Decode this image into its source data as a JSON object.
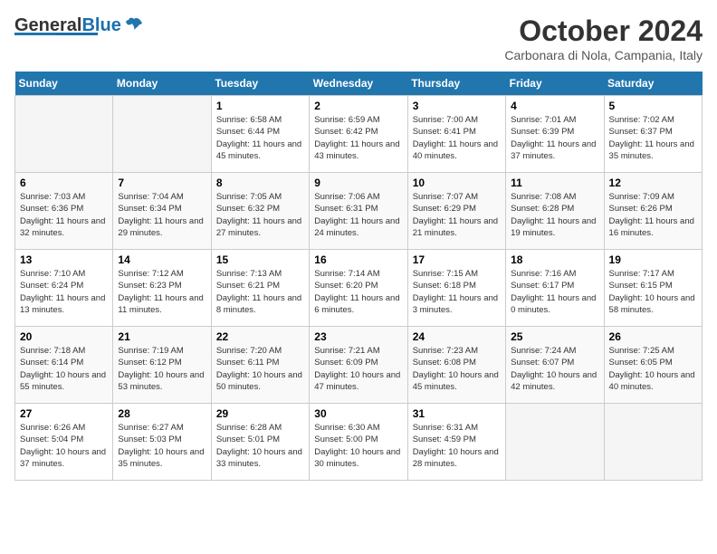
{
  "header": {
    "logo_general": "General",
    "logo_blue": "Blue",
    "title": "October 2024",
    "subtitle": "Carbonara di Nola, Campania, Italy"
  },
  "weekdays": [
    "Sunday",
    "Monday",
    "Tuesday",
    "Wednesday",
    "Thursday",
    "Friday",
    "Saturday"
  ],
  "weeks": [
    [
      {
        "day": "",
        "info": ""
      },
      {
        "day": "",
        "info": ""
      },
      {
        "day": "1",
        "info": "Sunrise: 6:58 AM\nSunset: 6:44 PM\nDaylight: 11 hours and 45 minutes."
      },
      {
        "day": "2",
        "info": "Sunrise: 6:59 AM\nSunset: 6:42 PM\nDaylight: 11 hours and 43 minutes."
      },
      {
        "day": "3",
        "info": "Sunrise: 7:00 AM\nSunset: 6:41 PM\nDaylight: 11 hours and 40 minutes."
      },
      {
        "day": "4",
        "info": "Sunrise: 7:01 AM\nSunset: 6:39 PM\nDaylight: 11 hours and 37 minutes."
      },
      {
        "day": "5",
        "info": "Sunrise: 7:02 AM\nSunset: 6:37 PM\nDaylight: 11 hours and 35 minutes."
      }
    ],
    [
      {
        "day": "6",
        "info": "Sunrise: 7:03 AM\nSunset: 6:36 PM\nDaylight: 11 hours and 32 minutes."
      },
      {
        "day": "7",
        "info": "Sunrise: 7:04 AM\nSunset: 6:34 PM\nDaylight: 11 hours and 29 minutes."
      },
      {
        "day": "8",
        "info": "Sunrise: 7:05 AM\nSunset: 6:32 PM\nDaylight: 11 hours and 27 minutes."
      },
      {
        "day": "9",
        "info": "Sunrise: 7:06 AM\nSunset: 6:31 PM\nDaylight: 11 hours and 24 minutes."
      },
      {
        "day": "10",
        "info": "Sunrise: 7:07 AM\nSunset: 6:29 PM\nDaylight: 11 hours and 21 minutes."
      },
      {
        "day": "11",
        "info": "Sunrise: 7:08 AM\nSunset: 6:28 PM\nDaylight: 11 hours and 19 minutes."
      },
      {
        "day": "12",
        "info": "Sunrise: 7:09 AM\nSunset: 6:26 PM\nDaylight: 11 hours and 16 minutes."
      }
    ],
    [
      {
        "day": "13",
        "info": "Sunrise: 7:10 AM\nSunset: 6:24 PM\nDaylight: 11 hours and 13 minutes."
      },
      {
        "day": "14",
        "info": "Sunrise: 7:12 AM\nSunset: 6:23 PM\nDaylight: 11 hours and 11 minutes."
      },
      {
        "day": "15",
        "info": "Sunrise: 7:13 AM\nSunset: 6:21 PM\nDaylight: 11 hours and 8 minutes."
      },
      {
        "day": "16",
        "info": "Sunrise: 7:14 AM\nSunset: 6:20 PM\nDaylight: 11 hours and 6 minutes."
      },
      {
        "day": "17",
        "info": "Sunrise: 7:15 AM\nSunset: 6:18 PM\nDaylight: 11 hours and 3 minutes."
      },
      {
        "day": "18",
        "info": "Sunrise: 7:16 AM\nSunset: 6:17 PM\nDaylight: 11 hours and 0 minutes."
      },
      {
        "day": "19",
        "info": "Sunrise: 7:17 AM\nSunset: 6:15 PM\nDaylight: 10 hours and 58 minutes."
      }
    ],
    [
      {
        "day": "20",
        "info": "Sunrise: 7:18 AM\nSunset: 6:14 PM\nDaylight: 10 hours and 55 minutes."
      },
      {
        "day": "21",
        "info": "Sunrise: 7:19 AM\nSunset: 6:12 PM\nDaylight: 10 hours and 53 minutes."
      },
      {
        "day": "22",
        "info": "Sunrise: 7:20 AM\nSunset: 6:11 PM\nDaylight: 10 hours and 50 minutes."
      },
      {
        "day": "23",
        "info": "Sunrise: 7:21 AM\nSunset: 6:09 PM\nDaylight: 10 hours and 47 minutes."
      },
      {
        "day": "24",
        "info": "Sunrise: 7:23 AM\nSunset: 6:08 PM\nDaylight: 10 hours and 45 minutes."
      },
      {
        "day": "25",
        "info": "Sunrise: 7:24 AM\nSunset: 6:07 PM\nDaylight: 10 hours and 42 minutes."
      },
      {
        "day": "26",
        "info": "Sunrise: 7:25 AM\nSunset: 6:05 PM\nDaylight: 10 hours and 40 minutes."
      }
    ],
    [
      {
        "day": "27",
        "info": "Sunrise: 6:26 AM\nSunset: 5:04 PM\nDaylight: 10 hours and 37 minutes."
      },
      {
        "day": "28",
        "info": "Sunrise: 6:27 AM\nSunset: 5:03 PM\nDaylight: 10 hours and 35 minutes."
      },
      {
        "day": "29",
        "info": "Sunrise: 6:28 AM\nSunset: 5:01 PM\nDaylight: 10 hours and 33 minutes."
      },
      {
        "day": "30",
        "info": "Sunrise: 6:30 AM\nSunset: 5:00 PM\nDaylight: 10 hours and 30 minutes."
      },
      {
        "day": "31",
        "info": "Sunrise: 6:31 AM\nSunset: 4:59 PM\nDaylight: 10 hours and 28 minutes."
      },
      {
        "day": "",
        "info": ""
      },
      {
        "day": "",
        "info": ""
      }
    ]
  ]
}
